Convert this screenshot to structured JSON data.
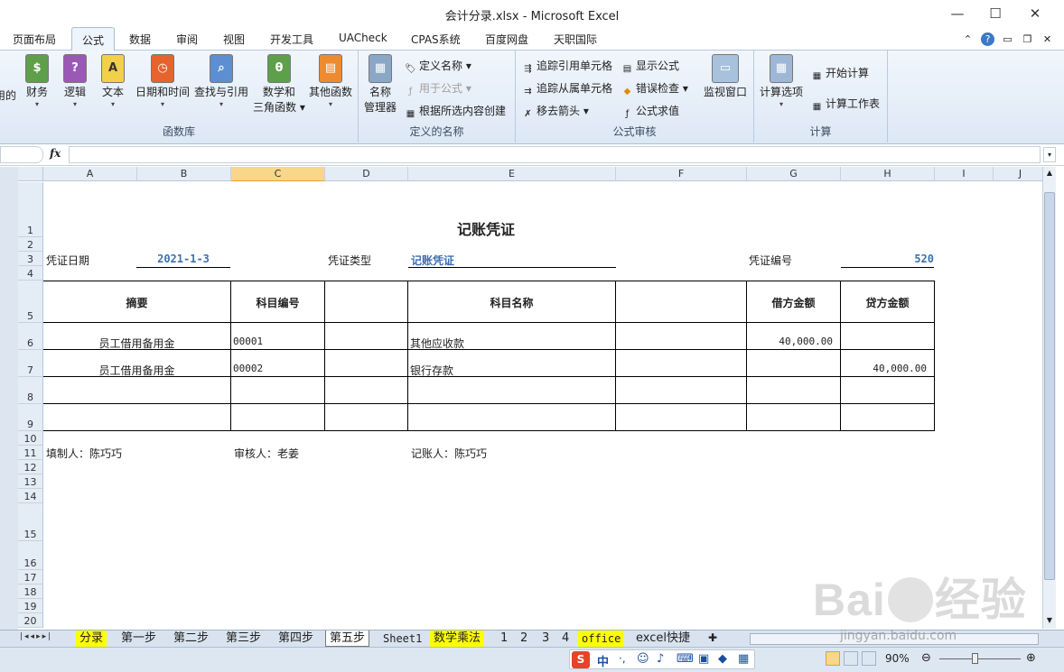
{
  "window": {
    "title": "会计分录.xlsx - Microsoft Excel",
    "minimize": "—",
    "maximize": "☐",
    "close": "✕"
  },
  "tabs": [
    "页面布局",
    "公式",
    "数据",
    "审阅",
    "视图",
    "开发工具",
    "UACheck",
    "CPAS系统",
    "百度网盘",
    "天职国际"
  ],
  "active_tab": "公式",
  "ribbon": {
    "func_lib": {
      "label": "函数库",
      "items": [
        "用的",
        "财务",
        "逻辑",
        "文本",
        "日期和时间",
        "查找与引用",
        "数学和",
        "三角函数",
        "其他函数"
      ]
    },
    "names": {
      "label": "定义的名称",
      "manager": "名称",
      "manager2": "管理器",
      "define": "定义名称",
      "use": "用于公式",
      "create": "根据所选内容创建"
    },
    "audit": {
      "label": "公式审核",
      "trace_pre": "追踪引用单元格",
      "trace_dep": "追踪从属单元格",
      "remove": "移去箭头",
      "show": "显示公式",
      "check": "错误检查",
      "eval": "公式求值",
      "watch": "监视窗口"
    },
    "calc": {
      "label": "计算",
      "options": "计算选项",
      "calc_now": "开始计算",
      "calc_sheet": "计算工作表"
    }
  },
  "formula_bar": {
    "fx": "fx",
    "value": ""
  },
  "columns": [
    "A",
    "B",
    "C",
    "D",
    "E",
    "F",
    "G",
    "H",
    "I",
    "J"
  ],
  "rows": [
    "1",
    "2",
    "3",
    "4",
    "5",
    "6",
    "7",
    "8",
    "9",
    "10",
    "11",
    "12",
    "13",
    "14",
    "15",
    "16",
    "17",
    "18",
    "19",
    "20"
  ],
  "voucher": {
    "title": "记账凭证",
    "date_label": "凭证日期",
    "date_value": "2021-1-3",
    "type_label": "凭证类型",
    "type_value": "记账凭证",
    "no_label": "凭证编号",
    "no_value": "520",
    "headers": {
      "summary": "摘要",
      "code": "科目编号",
      "name": "科目名称",
      "debit": "借方金额",
      "credit": "贷方金额"
    },
    "lines": [
      {
        "summary": "员工借用备用金",
        "code": "00001",
        "name": "其他应收款",
        "debit": "40,000.00",
        "credit": ""
      },
      {
        "summary": "员工借用备用金",
        "code": "00002",
        "name": "银行存款",
        "debit": "",
        "credit": "40,000.00"
      }
    ],
    "preparer": "填制人：陈巧巧",
    "reviewer": "审核人：老姜",
    "bookkeeper": "记账人：陈巧巧"
  },
  "sheet_tabs": [
    "分录",
    "第一步",
    "第二步",
    "第三步",
    "第四步",
    "第五步",
    "Sheet1",
    "数学乘法",
    "1",
    "2",
    "3",
    "4",
    "office",
    "excel快捷"
  ],
  "active_sheet": "第五步",
  "status": {
    "zoom": "90%",
    "ime": "中"
  },
  "watermark": {
    "text": "Bai",
    "text2": "经验",
    "sub": "jingyan.baidu.com"
  }
}
